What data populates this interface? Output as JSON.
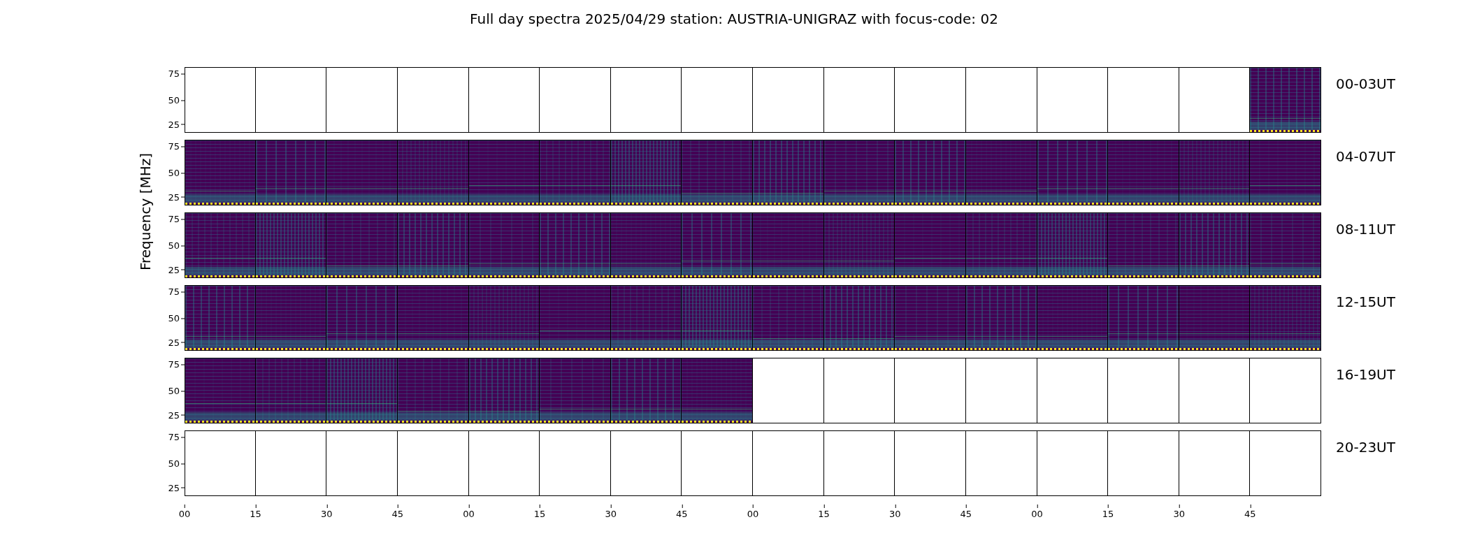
{
  "title": "Full day spectra 2025/04/29 station: AUSTRIA-UNIGRAZ with focus-code: 02",
  "ylabel": "Frequency [MHz]",
  "rows": [
    {
      "label": "00-03UT",
      "yticks": [
        "75",
        "50",
        "25"
      ],
      "panels": [
        {
          "has_data": false
        },
        {
          "has_data": false
        },
        {
          "has_data": false
        },
        {
          "has_data": false
        },
        {
          "has_data": false
        },
        {
          "has_data": false
        },
        {
          "has_data": false
        },
        {
          "has_data": false
        },
        {
          "has_data": false
        },
        {
          "has_data": false
        },
        {
          "has_data": false
        },
        {
          "has_data": false
        },
        {
          "has_data": false
        },
        {
          "has_data": false
        },
        {
          "has_data": false
        },
        {
          "has_data": true
        }
      ]
    },
    {
      "label": "04-07UT",
      "yticks": [
        "75",
        "50",
        "25"
      ],
      "panels": [
        {
          "has_data": true
        },
        {
          "has_data": true
        },
        {
          "has_data": true
        },
        {
          "has_data": true
        },
        {
          "has_data": true
        },
        {
          "has_data": true
        },
        {
          "has_data": true
        },
        {
          "has_data": true
        },
        {
          "has_data": true
        },
        {
          "has_data": true
        },
        {
          "has_data": true
        },
        {
          "has_data": true
        },
        {
          "has_data": true
        },
        {
          "has_data": true
        },
        {
          "has_data": true
        },
        {
          "has_data": true
        }
      ]
    },
    {
      "label": "08-11UT",
      "yticks": [
        "75",
        "50",
        "25"
      ],
      "panels": [
        {
          "has_data": true
        },
        {
          "has_data": true
        },
        {
          "has_data": true
        },
        {
          "has_data": true
        },
        {
          "has_data": true
        },
        {
          "has_data": true
        },
        {
          "has_data": true
        },
        {
          "has_data": true
        },
        {
          "has_data": true
        },
        {
          "has_data": true
        },
        {
          "has_data": true
        },
        {
          "has_data": true
        },
        {
          "has_data": true
        },
        {
          "has_data": true
        },
        {
          "has_data": true
        },
        {
          "has_data": true
        }
      ]
    },
    {
      "label": "12-15UT",
      "yticks": [
        "75",
        "50",
        "25"
      ],
      "panels": [
        {
          "has_data": true
        },
        {
          "has_data": true
        },
        {
          "has_data": true
        },
        {
          "has_data": true
        },
        {
          "has_data": true
        },
        {
          "has_data": true
        },
        {
          "has_data": true
        },
        {
          "has_data": true
        },
        {
          "has_data": true
        },
        {
          "has_data": true
        },
        {
          "has_data": true
        },
        {
          "has_data": true
        },
        {
          "has_data": true
        },
        {
          "has_data": true
        },
        {
          "has_data": true
        },
        {
          "has_data": true
        }
      ]
    },
    {
      "label": "16-19UT",
      "yticks": [
        "75",
        "50",
        "25"
      ],
      "panels": [
        {
          "has_data": true
        },
        {
          "has_data": true
        },
        {
          "has_data": true
        },
        {
          "has_data": true
        },
        {
          "has_data": true
        },
        {
          "has_data": true
        },
        {
          "has_data": true
        },
        {
          "has_data": true
        },
        {
          "has_data": false
        },
        {
          "has_data": false
        },
        {
          "has_data": false
        },
        {
          "has_data": false
        },
        {
          "has_data": false
        },
        {
          "has_data": false
        },
        {
          "has_data": false
        },
        {
          "has_data": false
        }
      ]
    },
    {
      "label": "20-23UT",
      "yticks": [
        "75",
        "50",
        "25"
      ],
      "panels": [
        {
          "has_data": false
        },
        {
          "has_data": false
        },
        {
          "has_data": false
        },
        {
          "has_data": false
        },
        {
          "has_data": false
        },
        {
          "has_data": false
        },
        {
          "has_data": false
        },
        {
          "has_data": false
        },
        {
          "has_data": false
        },
        {
          "has_data": false
        },
        {
          "has_data": false
        },
        {
          "has_data": false
        },
        {
          "has_data": false
        },
        {
          "has_data": false
        },
        {
          "has_data": false
        },
        {
          "has_data": false
        }
      ]
    }
  ],
  "xticks": [
    "00",
    "15",
    "30",
    "45",
    "00",
    "15",
    "30",
    "45",
    "00",
    "15",
    "30",
    "45",
    "00",
    "15",
    "30",
    "45"
  ]
}
